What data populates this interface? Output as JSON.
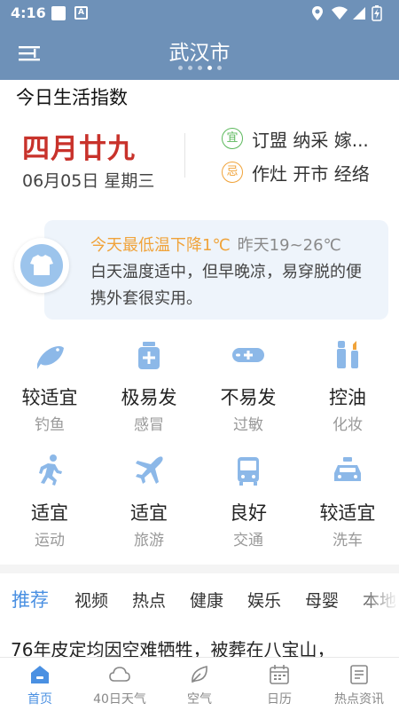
{
  "status_bar": {
    "time": "4:16",
    "notif_icon": "A"
  },
  "header": {
    "city": "武汉市",
    "page_dots": 5,
    "active_dot": 3
  },
  "life": {
    "title": "今日生活指数",
    "lunar_date": "四月廿九",
    "solar_date": "06月05日 星期三",
    "yi": {
      "badge": "宜",
      "text": "订盟 纳采 嫁...",
      "color": "#5cb85c"
    },
    "ji": {
      "badge": "忌",
      "text": "作灶 开市 经络",
      "color": "#f0a33a"
    }
  },
  "tip": {
    "warn": "今天最低温下降1℃",
    "yesterday": "昨天19~26℃",
    "desc": "白天温度适中，但早晚凉，易穿脱的便携外套很实用。"
  },
  "indices": [
    {
      "value": "较适宜",
      "label": "钓鱼",
      "icon": "fish-icon"
    },
    {
      "value": "极易发",
      "label": "感冒",
      "icon": "medicine-box-icon"
    },
    {
      "value": "不易发",
      "label": "过敏",
      "icon": "pill-icon"
    },
    {
      "value": "控油",
      "label": "化妆",
      "icon": "makeup-icon"
    },
    {
      "value": "适宜",
      "label": "运动",
      "icon": "running-icon"
    },
    {
      "value": "适宜",
      "label": "旅游",
      "icon": "airplane-icon"
    },
    {
      "value": "良好",
      "label": "交通",
      "icon": "bus-icon"
    },
    {
      "value": "较适宜",
      "label": "洗车",
      "icon": "car-icon"
    }
  ],
  "news": {
    "tabs": [
      "推荐",
      "视频",
      "热点",
      "健康",
      "娱乐",
      "母婴",
      "本地"
    ],
    "active_tab": 0,
    "headline": "76年皮定均因空难牺牲，被葬在八宝山，"
  },
  "bottom_nav": [
    {
      "label": "首页",
      "icon": "home-icon",
      "active": true
    },
    {
      "label": "40日天气",
      "icon": "cloud-icon",
      "active": false
    },
    {
      "label": "空气",
      "icon": "leaf-icon",
      "active": false
    },
    {
      "label": "日历",
      "icon": "calendar-icon",
      "active": false
    },
    {
      "label": "热点资讯",
      "icon": "news-icon",
      "active": false
    }
  ],
  "colors": {
    "header_bg": "#6e91b8",
    "accent": "#4a90e2",
    "lunar_red": "#c8322b",
    "icon_blue": "#8cb8e8"
  }
}
